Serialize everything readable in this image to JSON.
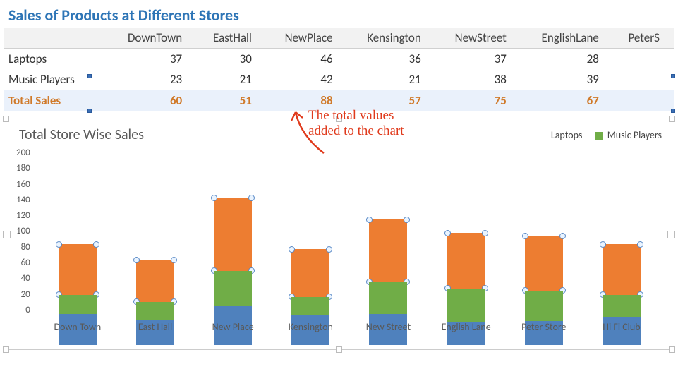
{
  "title": "Sales of Products at Different Stores",
  "table": {
    "columns": [
      "DownTown",
      "EastHall",
      "NewPlace",
      "Kensington",
      "NewStreet",
      "EnglishLane",
      "PeterS"
    ],
    "rows": [
      {
        "label": "Laptops",
        "values": [
          37,
          30,
          46,
          36,
          37,
          28
        ]
      },
      {
        "label": "Music Players",
        "values": [
          23,
          21,
          42,
          21,
          38,
          39
        ]
      }
    ],
    "total_row": {
      "label": "Total Sales",
      "values": [
        60,
        51,
        88,
        57,
        75,
        67
      ]
    }
  },
  "annotation": {
    "line1": "The total values",
    "line2": "added to the chart"
  },
  "chart_data": {
    "type": "bar",
    "title": "Total Store Wise Sales",
    "stacked": true,
    "categories": [
      "Down Town",
      "East Hall",
      "New Place",
      "Kensington",
      "New Street",
      "English Lane",
      "Peter Store",
      "Hi Fi Club"
    ],
    "series": [
      {
        "name": "Laptops",
        "color": "#4f81bd",
        "values": [
          37,
          30,
          46,
          36,
          37,
          28,
          29,
          34
        ]
      },
      {
        "name": "Music Players",
        "color": "#70ad47",
        "values": [
          23,
          21,
          42,
          21,
          38,
          39,
          36,
          26
        ]
      },
      {
        "name": "Total Sales",
        "color": "#ed7d31",
        "values": [
          60,
          51,
          88,
          57,
          75,
          67,
          65,
          60
        ]
      }
    ],
    "ylabel": "",
    "xlabel": "",
    "ylim": [
      0,
      200
    ],
    "yticks": [
      0,
      20,
      40,
      60,
      80,
      100,
      120,
      140,
      160,
      180,
      200
    ],
    "legend": [
      "Laptops",
      "Music Players"
    ],
    "selected_series": "Total Sales"
  }
}
